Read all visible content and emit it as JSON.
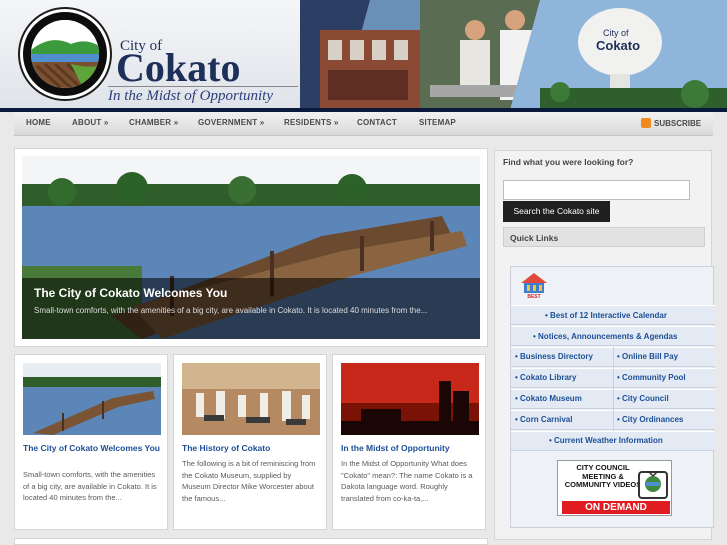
{
  "header": {
    "city_of": "City of",
    "name": "Cokato",
    "tagline": "In the Midst of Opportunity"
  },
  "nav": {
    "items": [
      {
        "label": "HOME"
      },
      {
        "label": "ABOUT »"
      },
      {
        "label": "CHAMBER »"
      },
      {
        "label": "GOVERNMENT »"
      },
      {
        "label": "RESIDENTS »"
      },
      {
        "label": "CONTACT"
      },
      {
        "label": "SITEMAP"
      }
    ],
    "subscribe": "SUBSCRIBE"
  },
  "feature": {
    "title": "The City of Cokato Welcomes You",
    "excerpt": "Small-town comforts, with the amenities of a big city, are available in Cokato. It is located 40 minutes from the..."
  },
  "cards": [
    {
      "title": "The City of Cokato Welcomes You",
      "excerpt": "Small-town comforts, with the amenities of a big city, are available in Cokato. It is located 40 minutes from the..."
    },
    {
      "title": "The History of Cokato",
      "excerpt": "The following is a bit of reminiscing from the Cokato Museum, supplied by Museum Director Mike Worcester about the famous..."
    },
    {
      "title": "In the Midst of Opportunity",
      "excerpt": "In the Midst of Opportunity What does \"Cokato\" mean?: The name Cokato is a Dakota language word. Roughly translated from co-ka-ta,..."
    }
  ],
  "sidebar": {
    "search_heading": "Find what you were looking for?",
    "search_placeholder": "",
    "search_button": "Search the Cokato site",
    "quick_links_heading": "Quick Links",
    "best_logo_text": "BEST",
    "links": {
      "calendar": "• Best of 12 Interactive Calendar",
      "notices": "• Notices, Announcements & Agendas",
      "business": "• Business Directory",
      "billpay": "• Online Bill Pay",
      "library": "• Cokato Library",
      "pool": "• Community Pool",
      "museum": "• Cokato Museum",
      "council": "• City Council",
      "carnival": "• Corn Carnival",
      "ordinances": "• City Ordinances",
      "weather": "• Current Weather Information"
    },
    "on_demand": {
      "title": "CITY COUNCIL MEETING & COMMUNITY VIDEOS",
      "label": "ON DEMAND"
    }
  },
  "colors": {
    "link_blue": "#1d4f96",
    "banner_navy": "#0b1e4a",
    "on_demand_red": "#e11b22"
  }
}
